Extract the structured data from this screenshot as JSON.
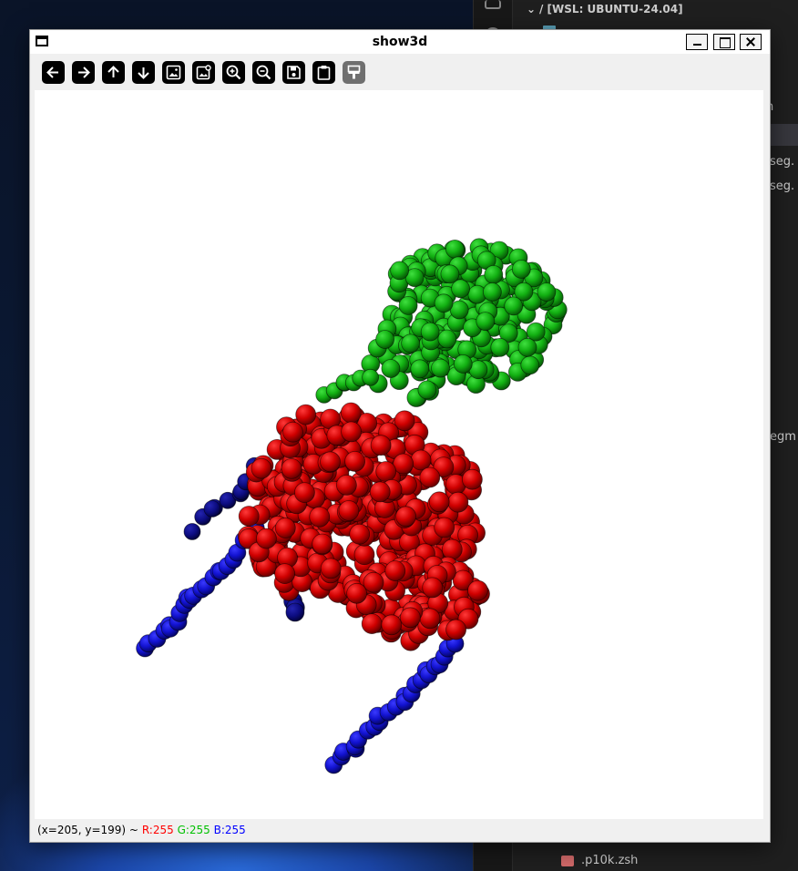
{
  "window": {
    "title": "show3d",
    "toolbar": [
      {
        "name": "pan-left-icon"
      },
      {
        "name": "pan-right-icon"
      },
      {
        "name": "pan-up-icon"
      },
      {
        "name": "pan-down-icon"
      },
      {
        "name": "image-icon"
      },
      {
        "name": "image-settings-icon"
      },
      {
        "name": "zoom-in-icon"
      },
      {
        "name": "zoom-out-icon"
      },
      {
        "name": "save-icon"
      },
      {
        "name": "copy-to-clipboard-icon"
      },
      {
        "name": "paint-brush-icon",
        "disabled": true
      }
    ],
    "status": {
      "coords": "(x=205, y=199) ~",
      "r": "R:255",
      "g": "G:255",
      "b": "B:255"
    }
  },
  "background_app": {
    "explorer_root": "/ [WSL: UBUNTU-24.04]",
    "items": [
      {
        "label": "seg."
      },
      {
        "label": "seg."
      },
      {
        "label": "egm"
      },
      {
        "label": "n"
      },
      {
        "label": ".p10k.zsh"
      }
    ]
  },
  "colors": {
    "red_cluster": "#d40000",
    "green_cluster": "#12b012",
    "blue_cluster": "#1414d8"
  }
}
